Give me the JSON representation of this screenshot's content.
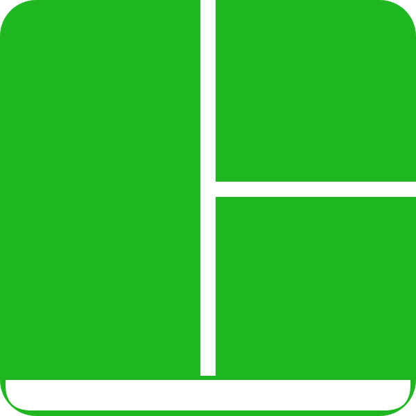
{
  "icon": {
    "name": "split-panel-layout-icon",
    "colors": {
      "fill": "#1fb722",
      "gap": "#ffffff"
    }
  }
}
